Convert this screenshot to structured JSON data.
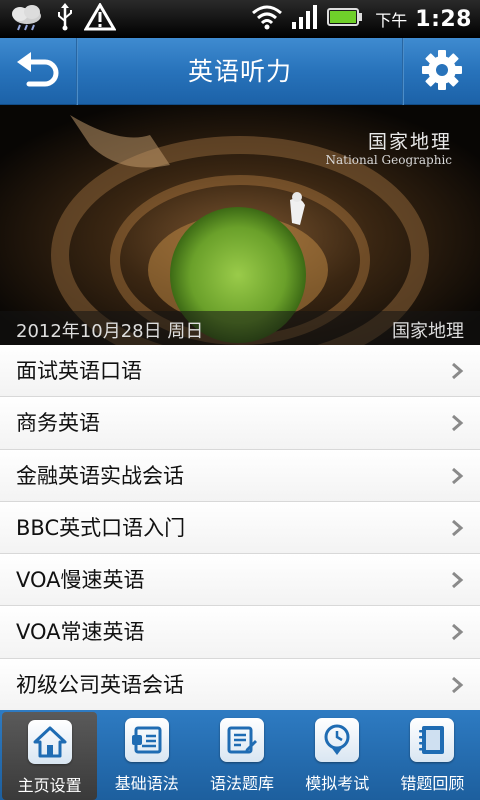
{
  "status_bar": {
    "icons": [
      "weather-cloud-icon",
      "usb-icon",
      "warning-icon",
      "wifi-icon",
      "signal-icon",
      "battery-icon"
    ],
    "ampm": "下午",
    "time": "1:28"
  },
  "header": {
    "title": "英语听力",
    "back_icon": "back-arrow-icon",
    "settings_icon": "gear-icon"
  },
  "banner": {
    "brand_cn": "国家地理",
    "brand_en": "National Geographic",
    "date": "2012年10月28日 周日",
    "source": "国家地理"
  },
  "list": {
    "items": [
      {
        "label": "面试英语口语"
      },
      {
        "label": "商务英语"
      },
      {
        "label": "金融英语实战会话"
      },
      {
        "label": "BBC英式口语入门"
      },
      {
        "label": "VOA慢速英语"
      },
      {
        "label": "VOA常速英语"
      },
      {
        "label": "初级公司英语会话"
      }
    ]
  },
  "bottom_nav": {
    "items": [
      {
        "label": "主页设置",
        "icon": "home-icon"
      },
      {
        "label": "基础语法",
        "icon": "grammar-card-icon"
      },
      {
        "label": "语法题库",
        "icon": "quiz-edit-icon"
      },
      {
        "label": "模拟考试",
        "icon": "clock-exam-icon"
      },
      {
        "label": "错题回顾",
        "icon": "notebook-icon"
      }
    ],
    "active_index": 0
  },
  "colors": {
    "header_blue": "#2873bb",
    "nav_blue": "#2e7bc2",
    "battery_green": "#6fcf2a"
  }
}
